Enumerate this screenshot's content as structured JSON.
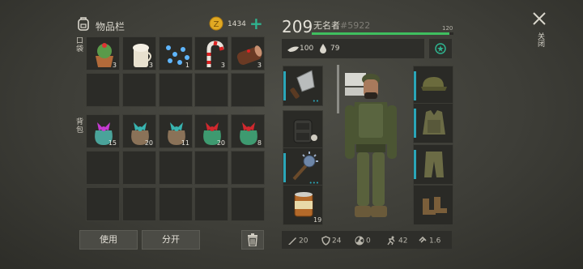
{
  "inventory": {
    "title": "物品栏",
    "coins": "1434",
    "pockets_label": "口袋",
    "backpack_label": "背包",
    "pocket_items": [
      {
        "icon": "cupcake-icon",
        "count": "3"
      },
      {
        "icon": "eggnog-cup-icon",
        "count": "3"
      },
      {
        "icon": "garland-lights-icon",
        "count": "1"
      },
      {
        "icon": "candy-cane-icon",
        "count": "3"
      },
      {
        "icon": "yule-log-cake-icon",
        "count": "3"
      }
    ],
    "backpack_items": [
      {
        "icon": "gift-bag-purple-icon",
        "count": "15"
      },
      {
        "icon": "gift-bag-teal-icon",
        "count": "20"
      },
      {
        "icon": "gift-bag-teal-icon",
        "count": "11"
      },
      {
        "icon": "gift-bag-red-icon",
        "count": "20"
      },
      {
        "icon": "gift-bag-red-icon",
        "count": "8"
      }
    ],
    "use_button": "使用",
    "split_button": "分开"
  },
  "player": {
    "level": "209",
    "name": "无名者",
    "tag": "#5922",
    "xp_max": "120",
    "xp_fraction": 0.97,
    "food": "100",
    "water": "79"
  },
  "equipment": {
    "left": [
      {
        "icon": "cleaver-icon",
        "count": ""
      },
      {
        "icon": "backpack-icon",
        "count": ""
      },
      {
        "icon": "spiked-mace-icon",
        "count": ""
      },
      {
        "icon": "canned-food-icon",
        "count": "19"
      }
    ],
    "right": [
      {
        "icon": "military-cap-icon"
      },
      {
        "icon": "military-vest-icon"
      },
      {
        "icon": "military-pants-icon"
      },
      {
        "icon": "military-boots-icon"
      }
    ]
  },
  "stats": {
    "attack": "20",
    "defense": "24",
    "radiation": "0",
    "speed": "42",
    "weight": "1.6"
  },
  "close_label": "关闭",
  "colors": {
    "accent": "#2fb38f",
    "xp_bar": "#3fbf5f",
    "slot_bar": "#2aa6b8"
  }
}
